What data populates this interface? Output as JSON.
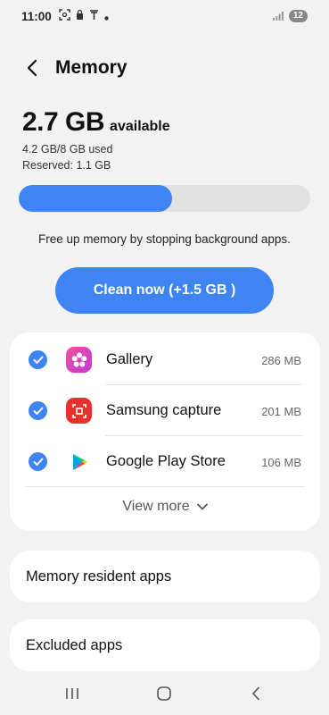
{
  "status_bar": {
    "time": "11:00",
    "battery": "12",
    "icons_left": [
      "screenshot-icon",
      "lock-icon",
      "usb-icon",
      "dot-icon"
    ],
    "icons_right": [
      "signal-icon",
      "battery-icon"
    ]
  },
  "header": {
    "title": "Memory",
    "back_icon": "back-arrow-icon"
  },
  "summary": {
    "available_value": "2.7 GB",
    "available_label": "available",
    "used_text": "4.2 GB/8 GB used",
    "reserved_text": "Reserved: 1.1 GB",
    "used_fraction": 0.525
  },
  "hint": "Free up memory by stopping background apps.",
  "clean_button": "Clean now (+1.5 GB )",
  "apps": [
    {
      "name": "Gallery",
      "size": "286 MB",
      "checked": true,
      "icon": "gallery-icon"
    },
    {
      "name": "Samsung capture",
      "size": "201 MB",
      "checked": true,
      "icon": "samsung-capture-icon"
    },
    {
      "name": "Google Play Store",
      "size": "106 MB",
      "checked": true,
      "icon": "play-store-icon"
    }
  ],
  "view_more": "View more",
  "menu": {
    "resident": "Memory resident apps",
    "excluded": "Excluded apps"
  },
  "colors": {
    "accent": "#3e84f5",
    "background": "#f2f2f2",
    "card": "#ffffff"
  },
  "nav": [
    "recents-icon",
    "home-icon",
    "back-icon"
  ]
}
